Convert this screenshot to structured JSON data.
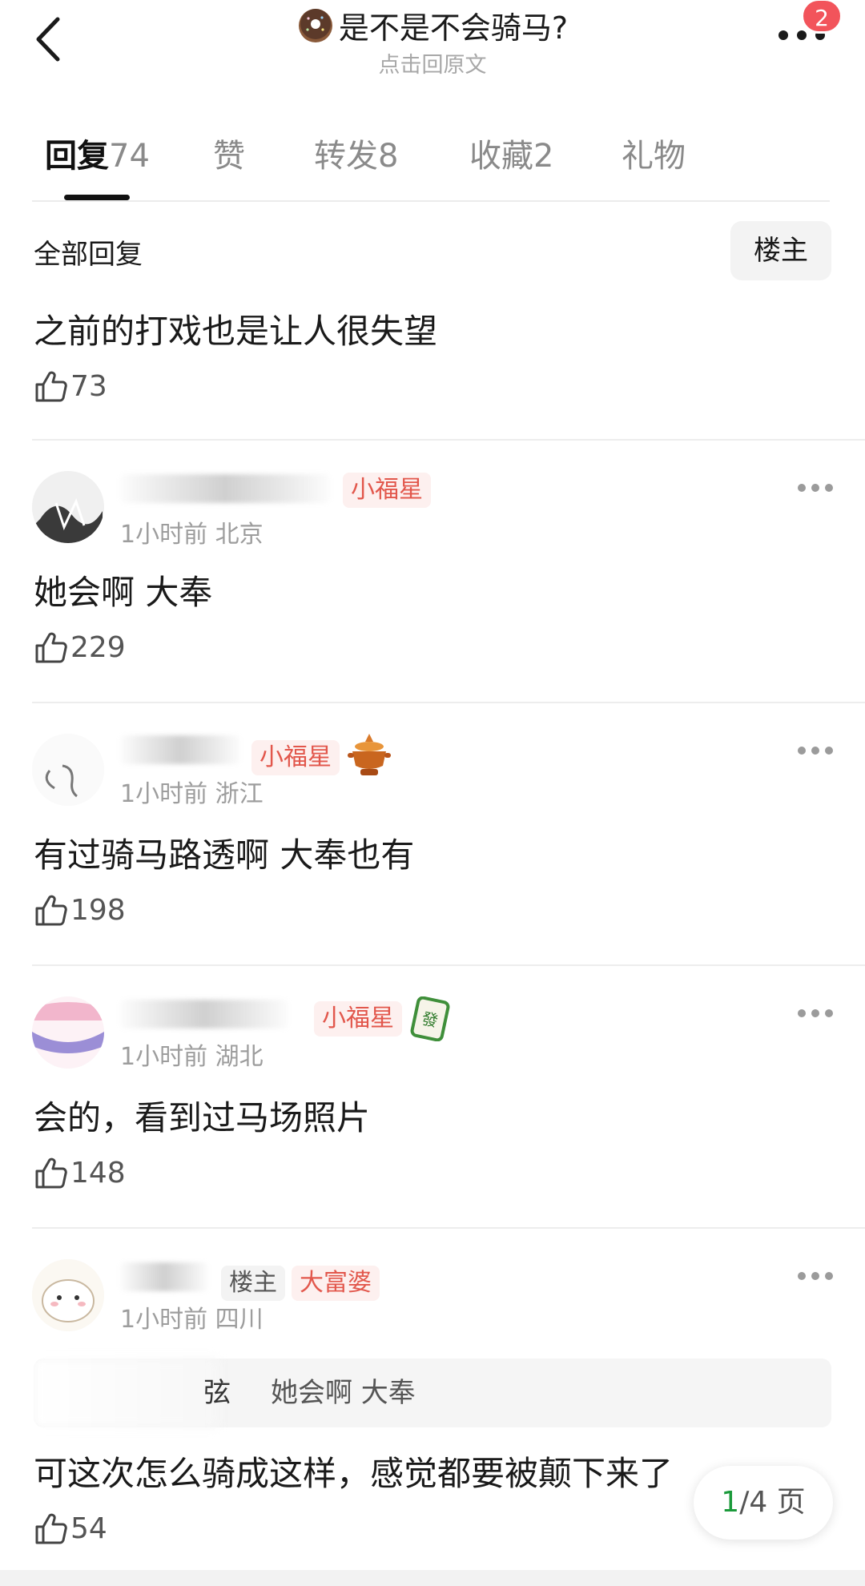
{
  "header": {
    "title": "是不是不会骑马?",
    "subtitle": "点击回原文",
    "badge_count": "2",
    "title_icon": "donut-emoji"
  },
  "tabs": [
    {
      "label": "回复",
      "count": "74",
      "active": true
    },
    {
      "label": "赞",
      "count": ""
    },
    {
      "label": "转发",
      "count": "8"
    },
    {
      "label": "收藏",
      "count": "2"
    },
    {
      "label": "礼物",
      "count": ""
    }
  ],
  "filter": {
    "all_replies_label": "全部回复",
    "op_only_label": "楼主"
  },
  "comments": [
    {
      "text": "之前的打戏也是让人很失望",
      "likes": "73"
    },
    {
      "tags": [
        "小福星"
      ],
      "time": "1小时前",
      "location": "北京",
      "text": "她会啊 大奉",
      "likes": "229"
    },
    {
      "tags": [
        "小福星"
      ],
      "badge_icon": "hotpot-icon",
      "time": "1小时前",
      "location": "浙江",
      "text": "有过骑马路透啊 大奉也有",
      "likes": "198"
    },
    {
      "tags": [
        "小福星"
      ],
      "badge_icon": "mahjong-fa-icon",
      "time": "1小时前",
      "location": "湖北",
      "text": "会的，看到过马场照片",
      "likes": "148"
    },
    {
      "tags": [
        "楼主",
        "大富婆"
      ],
      "time": "1小时前",
      "location": "四川",
      "quote_suffix": "弦",
      "quote_text": "她会啊 大奉",
      "text": "可这次怎么骑成这样，感觉都要被颠下来了",
      "likes": "54"
    }
  ],
  "pager": {
    "current": "1",
    "total_label": "/4 页"
  },
  "colors": {
    "accent_red": "#e2574c",
    "badge_red": "#f2545b",
    "pager_green": "#1b9a3b"
  }
}
